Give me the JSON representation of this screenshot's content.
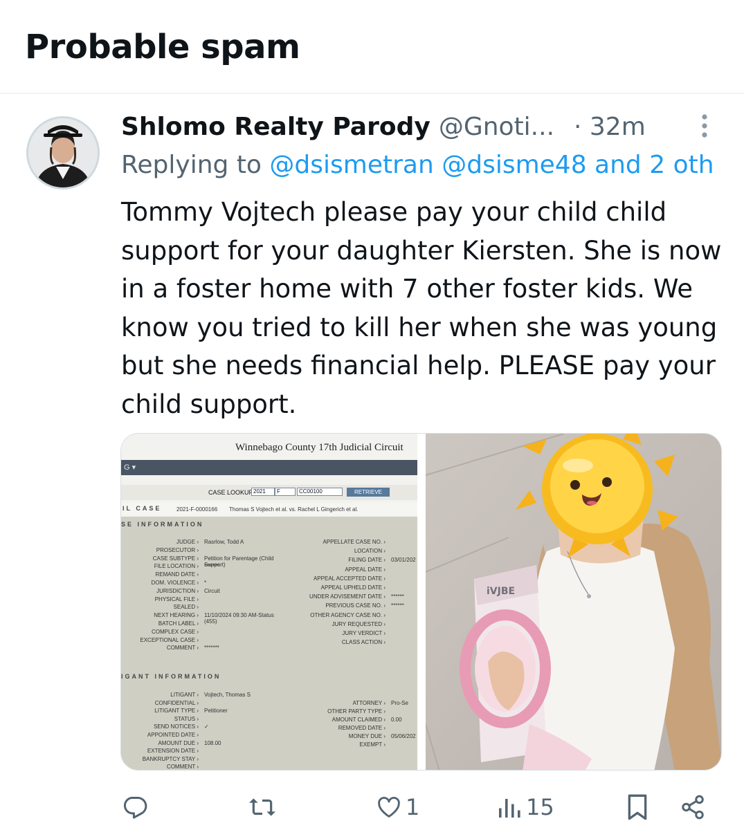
{
  "header": {
    "title": "Probable spam"
  },
  "tweet": {
    "author_name": "Shlomo Realty Parody",
    "author_handle": "@Gnoti...",
    "time": "· 32m",
    "replying_prefix": "Replying to ",
    "replying_mentions": "@dsismetran @dsisme48 and 2 oth",
    "text": "Tommy Vojtech please pay your child child support for your daughter Kiersten. She is now in a foster home with 7 other foster kids. We know you tried to kill her when she was young but she needs financial help. PLEASE pay your child support.",
    "more_icon": "more-vertical-icon"
  },
  "media": {
    "document": {
      "title": "Winnebago County 17th Judicial Circuit",
      "bar_label": "G ▾",
      "lookup_label": "CASE LOOKUP",
      "lookup_year": "2021",
      "lookup_type": "F",
      "lookup_number": "CC00100",
      "retrieve_label": "RETRIEVE",
      "case_line_label": "IL CASE",
      "case_number": "2021-F-0000166",
      "case_parties": "Thomas S Vojtech et al. vs. Rachel L Gingerich et al.",
      "case_section": "SE INFORMATION",
      "litigant_section": "IGANT INFORMATION",
      "left_fields": [
        [
          "JUDGE",
          "Rasrlow, Todd A"
        ],
        [
          "PROSECUTOR",
          ""
        ],
        [
          "CASE SUBTYPE",
          "Petition for Parentage (Child Support)"
        ],
        [
          "FILE LOCATION",
          "*******"
        ],
        [
          "REMAND DATE",
          ""
        ],
        [
          "DOM. VIOLENCE",
          "*"
        ],
        [
          "JURISDICTION",
          "Circuit"
        ],
        [
          "PHYSICAL FILE",
          ""
        ],
        [
          "SEALED",
          ""
        ],
        [
          "NEXT HEARING",
          "11/10/2024 09:30 AM-Status (455)"
        ],
        [
          "BATCH LABEL",
          ""
        ],
        [
          "COMPLEX CASE",
          ""
        ],
        [
          "EXCEPTIONAL CASE",
          ""
        ],
        [
          "COMMENT",
          "*******"
        ]
      ],
      "right_fields": [
        [
          "APPELLATE CASE NO.",
          ""
        ],
        [
          "LOCATION",
          ""
        ],
        [
          "FILING DATE",
          "03/01/202"
        ],
        [
          "APPEAL DATE",
          ""
        ],
        [
          "APPEAL ACCEPTED DATE",
          ""
        ],
        [
          "APPEAL UPHELD DATE",
          ""
        ],
        [
          "UNDER ADVISEMENT DATE",
          "******"
        ],
        [
          "PREVIOUS CASE NO.",
          "******"
        ],
        [
          "OTHER AGENCY CASE NO.",
          ""
        ],
        [
          "JURY REQUESTED",
          ""
        ],
        [
          "JURY VERDICT",
          ""
        ],
        [
          "CLASS ACTION",
          ""
        ]
      ],
      "litigant_left": [
        [
          "LITIGANT",
          "Vojtech, Thomas S"
        ],
        [
          "CONFIDENTIAL",
          ""
        ],
        [
          "LITIGANT TYPE",
          "Petitioner"
        ],
        [
          "STATUS",
          ""
        ],
        [
          "SEND NOTICES",
          "✓"
        ],
        [
          "APPOINTED DATE",
          ""
        ],
        [
          "AMOUNT DUE",
          "108.00"
        ],
        [
          "EXTENSION DATE",
          ""
        ],
        [
          "BANKRUPTCY STAY",
          ""
        ],
        [
          "COMMENT",
          ""
        ]
      ],
      "litigant_right": [
        [
          "ATTORNEY",
          "Pro-Se"
        ],
        [
          "OTHER PARTY TYPE",
          ""
        ],
        [
          "AMOUNT CLAIMED",
          "0.00"
        ],
        [
          "REMOVED DATE",
          ""
        ],
        [
          "MONEY DUE",
          "05/06/202"
        ],
        [
          "EXEMPT",
          ""
        ]
      ]
    },
    "photo": {
      "product_label": "iVJBE"
    }
  },
  "actions": {
    "reply_icon": "reply-icon",
    "retweet_icon": "retweet-icon",
    "like_icon": "heart-icon",
    "like_count": "1",
    "views_icon": "views-chart-icon",
    "views_count": "15",
    "bookmark_icon": "bookmark-icon",
    "share_icon": "share-icon"
  },
  "colors": {
    "accent": "#1d9bf0",
    "muted": "#536471",
    "text": "#0f1419"
  }
}
